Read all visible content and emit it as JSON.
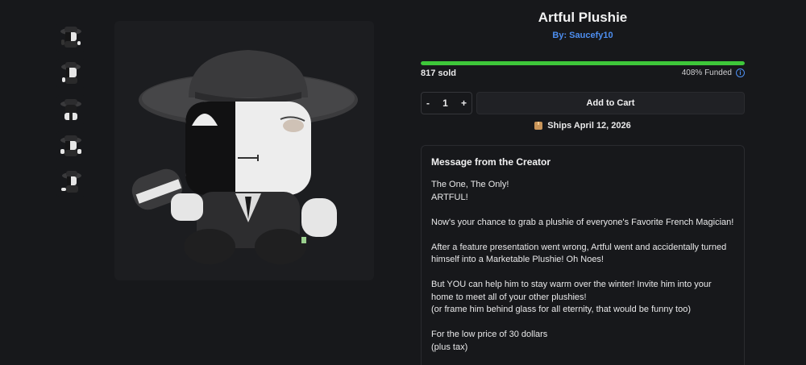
{
  "product": {
    "title": "Artful Plushie",
    "creator": "By: Saucefy10"
  },
  "thumbnails": [
    {
      "icon": "plushie-front-thumbnail"
    },
    {
      "icon": "plushie-side-thumbnail"
    },
    {
      "icon": "plushie-back-thumbnail"
    },
    {
      "icon": "plushie-angle-thumbnail"
    },
    {
      "icon": "plushie-profile-thumbnail"
    }
  ],
  "funding": {
    "sold": "817 sold",
    "funded": "408% Funded",
    "progress_fraction": 1.0,
    "bar_color": "#3ec73a"
  },
  "cart": {
    "decrement": "-",
    "quantity": "1",
    "increment": "+",
    "add_label": "Add to Cart"
  },
  "shipping": {
    "label": "Ships April 12, 2026"
  },
  "message": {
    "heading": "Message from the Creator",
    "paragraphs": [
      "The One, The Only!\nARTFUL!",
      "Now's your chance to grab a plushie of everyone's Favorite French Magician!",
      "After a feature presentation went wrong, Artful went and accidentally turned himself into a Marketable Plushie! Oh Noes!",
      "But YOU can help him to stay warm over the winter! Invite him into your home to meet all of your other plushies!\n(or frame him behind glass for all eternity, that would be funny too)",
      "For the low price of 30 dollars\n(plus tax)"
    ]
  },
  "colors": {
    "background": "#17181b",
    "link": "#4d8ef0",
    "progress": "#3ec73a"
  }
}
